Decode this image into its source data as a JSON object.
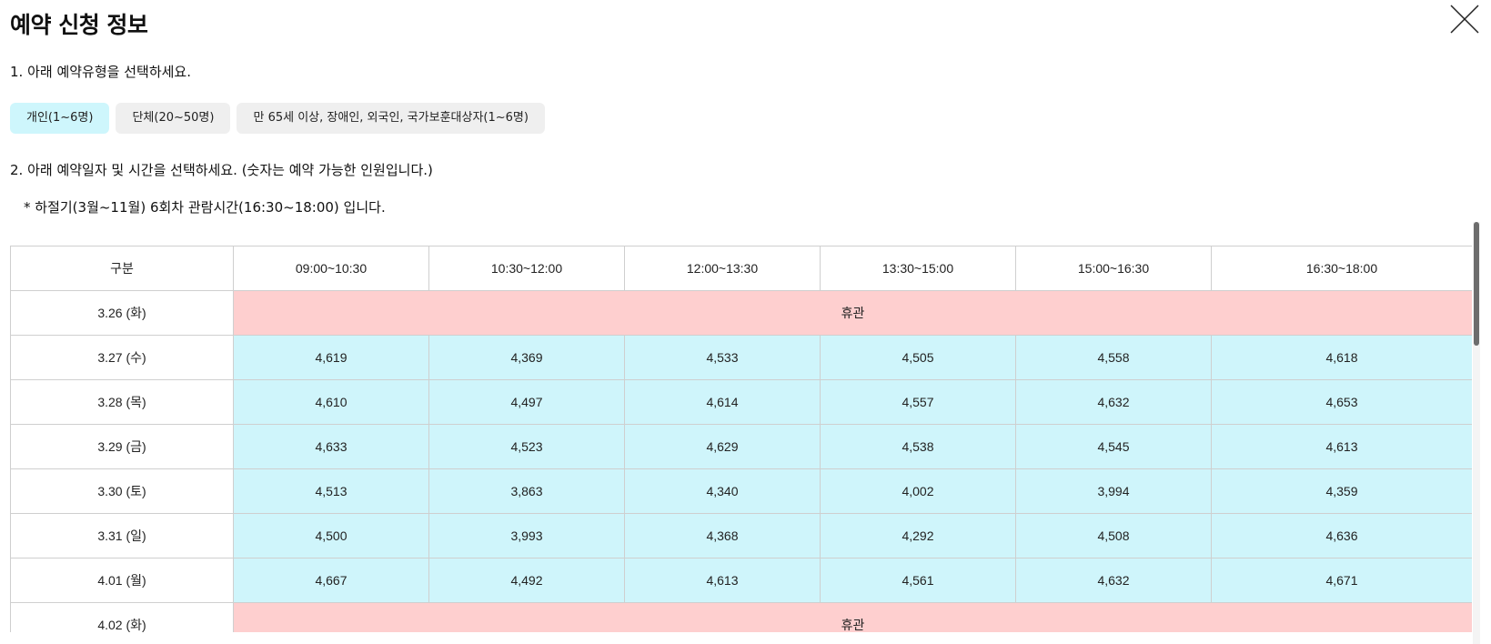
{
  "title": "예약 신청 정보",
  "step1": "1. 아래 예약유형을 선택하세요.",
  "types": [
    {
      "label": "개인(1~6명)",
      "active": true
    },
    {
      "label": "단체(20~50명)",
      "active": false
    },
    {
      "label": "만 65세 이상, 장애인, 외국인, 국가보훈대상자(1~6명)",
      "active": false
    }
  ],
  "step2": "2. 아래 예약일자 및 시간을 선택하세요. (숫자는 예약 가능한 인원입니다.)",
  "note": "* 하절기(3월~11월) 6회차 관람시간(16:30~18:00) 입니다.",
  "table": {
    "headers": [
      "구분",
      "09:00~10:30",
      "10:30~12:00",
      "12:00~13:30",
      "13:30~15:00",
      "15:00~16:30",
      "16:30~18:00"
    ],
    "rows": [
      {
        "date": "3.26 (화)",
        "closed": "휴관"
      },
      {
        "date": "3.27 (수)",
        "values": [
          "4,619",
          "4,369",
          "4,533",
          "4,505",
          "4,558",
          "4,618"
        ]
      },
      {
        "date": "3.28 (목)",
        "values": [
          "4,610",
          "4,497",
          "4,614",
          "4,557",
          "4,632",
          "4,653"
        ]
      },
      {
        "date": "3.29 (금)",
        "values": [
          "4,633",
          "4,523",
          "4,629",
          "4,538",
          "4,545",
          "4,613"
        ]
      },
      {
        "date": "3.30 (토)",
        "values": [
          "4,513",
          "3,863",
          "4,340",
          "4,002",
          "3,994",
          "4,359"
        ]
      },
      {
        "date": "3.31 (일)",
        "values": [
          "4,500",
          "3,993",
          "4,368",
          "4,292",
          "4,508",
          "4,636"
        ]
      },
      {
        "date": "4.01 (월)",
        "values": [
          "4,667",
          "4,492",
          "4,613",
          "4,561",
          "4,632",
          "4,671"
        ]
      },
      {
        "date": "4.02 (화)",
        "closed": "휴관"
      }
    ]
  },
  "colors": {
    "available": "#cff5fb",
    "closed": "#fecfcf",
    "active_type": "#cef6fc",
    "inactive_type": "#efefef"
  },
  "icons": {
    "close": "close-icon"
  }
}
